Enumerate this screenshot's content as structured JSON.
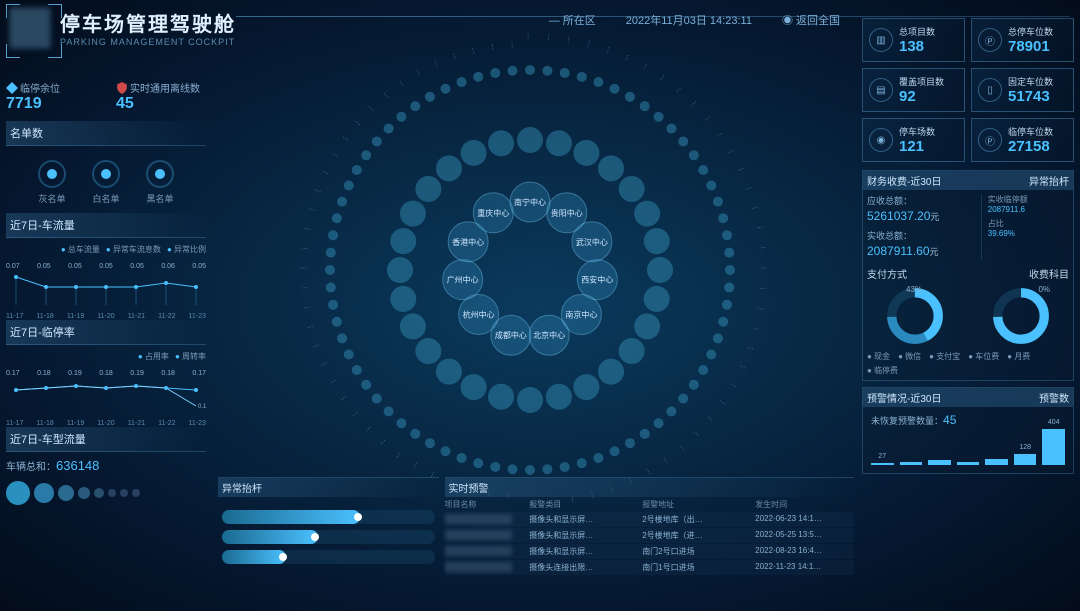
{
  "header": {
    "title_cn": "停车场管理驾驶舱",
    "title_en": "PARKING MANAGEMENT COCKPIT",
    "datetime": "2022年11月03日 14:23:11",
    "location_label": "所在区",
    "return_national": "返回全国"
  },
  "left": {
    "temp_parking": {
      "label": "临停余位",
      "value": "7719"
    },
    "online_rate": {
      "label": "实时通用离线数",
      "value": "45"
    },
    "lists_title": "名单数",
    "lists": [
      {
        "label": "灰名单"
      },
      {
        "label": "白名单"
      },
      {
        "label": "黑名单"
      }
    ],
    "flow7d_title": "近7日-车流量",
    "flow7d_legend": [
      "总车流量",
      "异常车流息数",
      "异常比例"
    ],
    "temp7d_title": "近7日-临停率",
    "temp7d_legend": [
      "占用率",
      "周转率"
    ],
    "type7d_title": "近7日-车型流量",
    "vehicle_total_label": "车辆总和：",
    "vehicle_total_value": "636148"
  },
  "chart_data": [
    {
      "type": "line",
      "title": "近7日-车流量",
      "categories": [
        "11-17",
        "11-18",
        "11-19",
        "11-20",
        "11-21",
        "11-22",
        "11-23"
      ],
      "series": [
        {
          "name": "异常比例",
          "values": [
            0.07,
            0.05,
            0.05,
            0.05,
            0.05,
            0.06,
            0.05
          ]
        }
      ],
      "ylim": [
        0,
        0.1
      ]
    },
    {
      "type": "line",
      "title": "近7日-临停率",
      "categories": [
        "11-17",
        "11-18",
        "11-19",
        "11-20",
        "11-21",
        "11-22",
        "11-23"
      ],
      "series": [
        {
          "name": "占用率",
          "values": [
            0.17,
            0.18,
            0.19,
            0.18,
            0.19,
            0.18,
            0.17
          ]
        },
        {
          "name": "周转率",
          "values": [
            0.17,
            0.18,
            0.19,
            0.18,
            0.19,
            0.18,
            0.12
          ]
        }
      ],
      "ylim": [
        0,
        0.25
      ]
    },
    {
      "type": "bar",
      "title": "预警数",
      "categories": [
        "",
        "",
        "",
        "",
        "",
        "",
        ""
      ],
      "series": [
        {
          "name": "预警数",
          "values": [
            27,
            35,
            56,
            36,
            64,
            128,
            404
          ]
        }
      ],
      "visible_labels": [
        27,
        128,
        404
      ],
      "ylim": [
        0,
        450
      ]
    }
  ],
  "right": {
    "stats": [
      {
        "icon": "chart",
        "label": "总项目数",
        "value": "138"
      },
      {
        "icon": "P",
        "label": "总停车位数",
        "value": "78901"
      },
      {
        "icon": "doc",
        "label": "覆盖项目数",
        "value": "92"
      },
      {
        "icon": "slot",
        "label": "固定车位数",
        "value": "51743"
      },
      {
        "icon": "pin",
        "label": "停车场数",
        "value": "121"
      },
      {
        "icon": "P",
        "label": "临停车位数",
        "value": "27158"
      }
    ],
    "fin_title": "财务收费-近30日",
    "fin_sub": "异常抬杆",
    "receivable_label": "应收总额：",
    "receivable_value": "5261037.20",
    "receivable_unit": "元",
    "actual_label": "实收总额：",
    "actual_value": "2087911.60",
    "actual_unit": "元",
    "side_label1": "实收临停额",
    "side_value1": "2087911.6",
    "side_label2": "占比",
    "side_value2": "39.69%",
    "pay_method_title": "支付方式",
    "fee_subject_title": "收费科目",
    "pay_pct1": "43%",
    "fee_pct1": "0%",
    "pay_legend": [
      "现金",
      "微信",
      "支付宝",
      "车位费",
      "月费",
      "临停费"
    ],
    "alert_title": "预警情况-近30日",
    "alert_sub": "预警数",
    "pending_label": "未恢复预警数量：",
    "pending_value": "45"
  },
  "bottom": {
    "abnormal_title": "异常抬杆",
    "realtime_title": "实时预警",
    "th": [
      "项目名称",
      "报警类目",
      "报警地址",
      "发生时间"
    ],
    "rows": [
      {
        "cat": "摄像头和显示屏…",
        "addr": "2号楼地库（出…",
        "time": "2022-06-23 14:1…"
      },
      {
        "cat": "摄像头和显示屏…",
        "addr": "2号楼地库（进…",
        "time": "2022-05-25 13:5…"
      },
      {
        "cat": "摄像头和显示屏…",
        "addr": "南门2号口进场",
        "time": "2022-08-23 16:4…"
      },
      {
        "cat": "摄像头连接出限…",
        "addr": "南门1号口进场",
        "time": "2022-11-23 14:1…"
      }
    ]
  },
  "hub_labels": [
    "南宁中心",
    "贵阳中心",
    "武汉中心",
    "西安中心",
    "南京中心",
    "北京中心",
    "成都中心",
    "杭州中心",
    "广州中心",
    "香港中心",
    "重庆中心"
  ]
}
